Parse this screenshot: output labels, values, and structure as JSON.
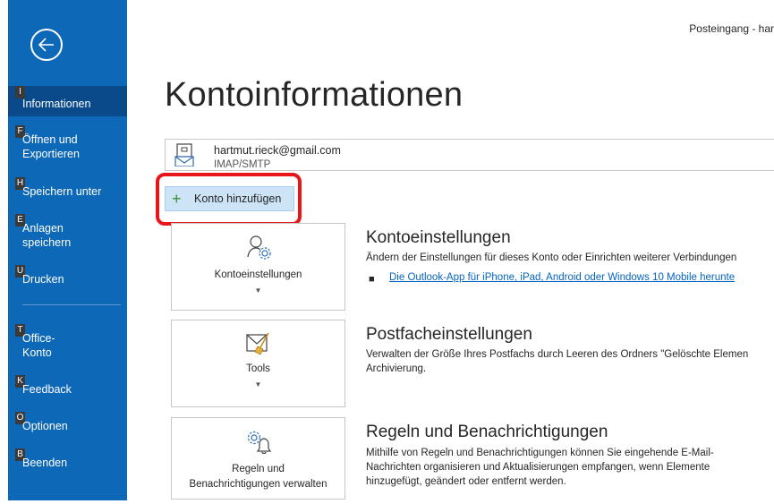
{
  "window": {
    "title": "Posteingang - har"
  },
  "sidebar": {
    "back_icon": "back-arrow-icon",
    "items": [
      {
        "key": "I",
        "label": "Informationen"
      },
      {
        "key": "F",
        "label_line1": "Öffnen und",
        "label_line2": "Exportieren"
      },
      {
        "key": "H",
        "label": "Speichern unter"
      },
      {
        "key": "E",
        "label_line1": "Anlagen",
        "label_line2": "speichern"
      },
      {
        "key": "U",
        "label": "Drucken"
      },
      {
        "key": "T",
        "label_line1": "Office-",
        "label_line2": "Konto"
      },
      {
        "key": "K",
        "label": "Feedback"
      },
      {
        "key": "O",
        "label": "Optionen"
      },
      {
        "key": "B",
        "label": "Beenden"
      }
    ]
  },
  "main": {
    "title": "Kontoinformationen",
    "account": {
      "email": "hartmut.rieck@gmail.com",
      "type": "IMAP/SMTP"
    },
    "add_account_label": "Konto hinzufügen",
    "sections": [
      {
        "tile_label": "Kontoeinstellungen",
        "title": "Kontoeinstellungen",
        "desc": "Ändern der Einstellungen für dieses Konto oder Einrichten weiterer Verbindungen",
        "link": "Die Outlook-App für iPhone, iPad, Android oder Windows 10 Mobile herunte"
      },
      {
        "tile_label": "Tools",
        "title": "Postfacheinstellungen",
        "desc_line1": "Verwalten der Größe Ihres Postfachs durch Leeren des Ordners \"Gelöschte Elemen",
        "desc_line2": "Archivierung."
      },
      {
        "tile_label_line1": "Regeln und",
        "tile_label_line2": "Benachrichtigungen verwalten",
        "title": "Regeln und Benachrichtigungen",
        "desc_line1": "Mithilfe von Regeln und Benachrichtigungen können Sie eingehende E-Mail-",
        "desc_line2": "Nachrichten organisieren und Aktualisierungen empfangen, wenn Elemente",
        "desc_line3": "hinzugefügt, geändert oder entfernt werden."
      }
    ]
  },
  "colors": {
    "sidebar": "#0e68b8",
    "sidebar_active": "#0a4a8a",
    "highlight": "#e8151b",
    "link": "#0563c1"
  }
}
